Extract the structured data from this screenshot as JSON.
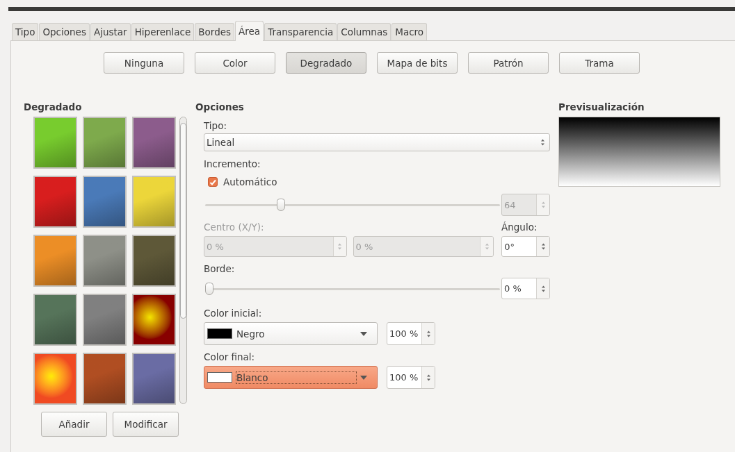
{
  "tabs": [
    {
      "label": "Tipo",
      "selected": false
    },
    {
      "label": "Opciones",
      "selected": false
    },
    {
      "label": "Ajustar",
      "selected": false
    },
    {
      "label": "Hiperenlace",
      "selected": false
    },
    {
      "label": "Bordes",
      "selected": false
    },
    {
      "label": "Área",
      "selected": true
    },
    {
      "label": "Transparencia",
      "selected": false
    },
    {
      "label": "Columnas",
      "selected": false
    },
    {
      "label": "Macro",
      "selected": false
    }
  ],
  "fill_buttons": [
    {
      "label": "Ninguna",
      "selected": false
    },
    {
      "label": "Color",
      "selected": false
    },
    {
      "label": "Degradado",
      "selected": true
    },
    {
      "label": "Mapa de bits",
      "selected": false
    },
    {
      "label": "Patrón",
      "selected": false
    },
    {
      "label": "Trama",
      "selected": false
    }
  ],
  "gradient_list": {
    "title": "Degradado",
    "swatches": [
      {
        "kind": "linear",
        "color": "#78cc2e"
      },
      {
        "kind": "linear",
        "color": "#7eaa4c"
      },
      {
        "kind": "linear",
        "color": "#8c5c8c"
      },
      {
        "kind": "linear",
        "color": "#d81e1e"
      },
      {
        "kind": "linear",
        "color": "#4a7ab8"
      },
      {
        "kind": "linear",
        "color": "#ecd63a"
      },
      {
        "kind": "linear",
        "color": "#ec8e26"
      },
      {
        "kind": "linear",
        "color": "#8e9088"
      },
      {
        "kind": "linear",
        "color": "#5e5838"
      },
      {
        "kind": "linear",
        "color": "#56745a"
      },
      {
        "kind": "linear",
        "color": "#808080"
      },
      {
        "kind": "radial",
        "color": "#880000"
      },
      {
        "kind": "radial",
        "color": "#f04a22"
      },
      {
        "kind": "linear",
        "color": "#b04e22"
      },
      {
        "kind": "linear",
        "color": "#6a6ca4"
      }
    ],
    "buttons": [
      {
        "label": "Añadir"
      },
      {
        "label": "Modificar"
      }
    ]
  },
  "options": {
    "title": "Opciones",
    "type_label": "Tipo:",
    "type_value": "Lineal",
    "increment_label": "Incremento:",
    "automatic": {
      "label": "Automático",
      "checked": true
    },
    "increment_slider": {
      "level": 0.25
    },
    "increment_value": {
      "value": "64",
      "disabled": true
    },
    "center_label": {
      "text": "Centro (X/Y):",
      "disabled": true
    },
    "center_x": {
      "value": "0 %",
      "disabled": true
    },
    "center_y": {
      "value": "0 %",
      "disabled": true
    },
    "angle_label": "Ángulo:",
    "angle": {
      "value": "0°",
      "disabled": false
    },
    "border_label": "Borde:",
    "border_slider": {
      "level": 0
    },
    "border_value": {
      "value": "0 %",
      "disabled": false
    },
    "start_color": {
      "label": "Color inicial:",
      "name": "Negro",
      "color": "#000000",
      "focused": false,
      "opacity": "100 %"
    },
    "end_color": {
      "label": "Color final:",
      "name": "Blanco",
      "color": "#ffffff",
      "focused": true,
      "opacity": "100 %"
    }
  },
  "preview": {
    "title": "Previsualización"
  }
}
